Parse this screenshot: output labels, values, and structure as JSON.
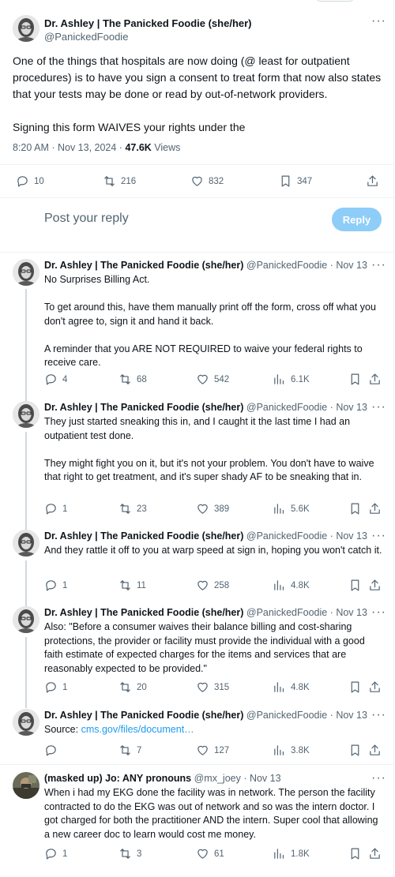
{
  "main": {
    "author_name": "Dr. Ashley | The Panicked Foodie (she/her)",
    "author_handle": "@PanickedFoodie",
    "text": "One of the things that hospitals are now doing (@ least for outpatient procedures) is to have you sign a consent to treat form that now also states that your tests may be done or read by out-of-network providers.\n\nSigning this form WAIVES your rights under the",
    "time": "8:20 AM · Nov 13, 2024 · ",
    "views_count": "47.6K",
    "views_label": " Views",
    "replies": "10",
    "reposts": "216",
    "likes": "832",
    "bookmarks": "347"
  },
  "composer": {
    "placeholder": "Post your reply",
    "button_label": "Reply"
  },
  "replies": [
    {
      "name": "Dr. Ashley | The Panicked Foodie (she/her)",
      "meta": " @PanickedFoodie · Nov 13",
      "text": "No Surprises Billing Act.\n\nTo get around this, have them manually print off the form, cross off what you don't agree to, sign it and hand it back.\n\nA reminder that you ARE NOT REQUIRED to waive your federal rights to receive care.",
      "replies": "4",
      "reposts": "68",
      "likes": "542",
      "views": "6.1K"
    },
    {
      "name": "Dr. Ashley | The Panicked Foodie (she/her)",
      "meta": " @PanickedFoodie · Nov 13",
      "text": "They just started sneaking this in, and I caught it the last time I had an outpatient test done.\n\nThey might fight you on it, but it's not your problem. You don't have to waive that right to get treatment, and it's super shady AF to be sneaking that in.",
      "replies": "1",
      "reposts": "23",
      "likes": "389",
      "views": "5.6K"
    },
    {
      "name": "Dr. Ashley | The Panicked Foodie (she/her)",
      "meta": " @PanickedFoodie · Nov 13",
      "text": "And they rattle it off to you at warp speed at sign in, hoping you won't catch it.",
      "replies": "1",
      "reposts": "11",
      "likes": "258",
      "views": "4.8K"
    },
    {
      "name": "Dr. Ashley | The Panicked Foodie (she/her)",
      "meta": " @PanickedFoodie · Nov 13",
      "text": "Also: \"Before a consumer waives their balance billing and cost-sharing protections, the provider or facility must provide the individual with a good faith estimate of expected charges for the items and services that are reasonably expected to be provided.\"",
      "replies": "1",
      "reposts": "20",
      "likes": "315",
      "views": "4.8K"
    },
    {
      "name": "Dr. Ashley | The Panicked Foodie (she/her)",
      "meta": " @PanickedFoodie · Nov 13",
      "text_prefix": "Source: ",
      "link": "cms.gov/files/document…",
      "replies": "",
      "reposts": "7",
      "likes": "127",
      "views": "3.8K"
    },
    {
      "name": "(masked up) Jo: ANY pronouns",
      "meta": " @mx_joey · Nov 13",
      "text": "When i had my EKG done the facility was in network. The person the facility contracted to do the EKG was out of network and so was the intern doctor. I got charged for both the practitioner AND the intern. Super cool that allowing a new career doc to learn would cost me money.",
      "replies": "1",
      "reposts": "3",
      "likes": "61",
      "views": "1.8K"
    }
  ]
}
